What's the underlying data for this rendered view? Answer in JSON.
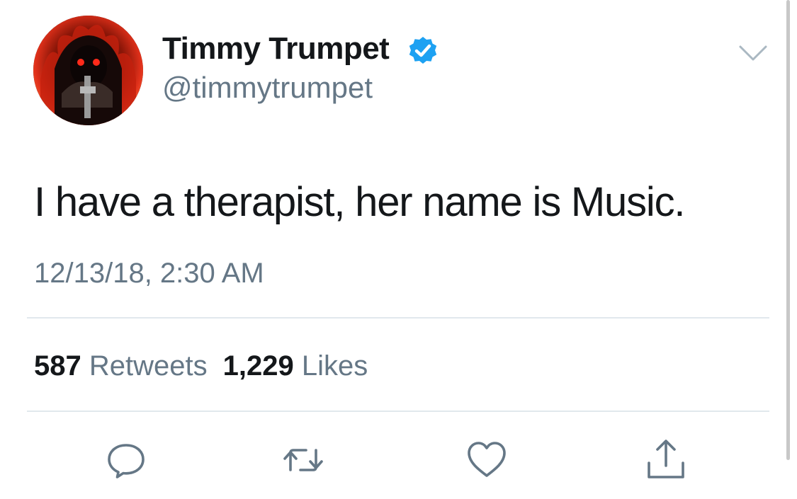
{
  "tweet": {
    "display_name": "Timmy Trumpet",
    "handle": "@timmytrumpet",
    "verified": true,
    "text": "I have a therapist, her name is Music.",
    "timestamp": "12/13/18, 2:30 AM",
    "stats": {
      "retweets_count": "587",
      "retweets_label": "Retweets",
      "likes_count": "1,229",
      "likes_label": "Likes"
    },
    "actions": [
      "reply-icon",
      "retweet-icon",
      "like-icon",
      "share-icon"
    ]
  },
  "colors": {
    "verified_blue": "#1da1f2",
    "secondary_text": "#657786",
    "primary_text": "#14171a",
    "divider": "#e1e8ed"
  }
}
